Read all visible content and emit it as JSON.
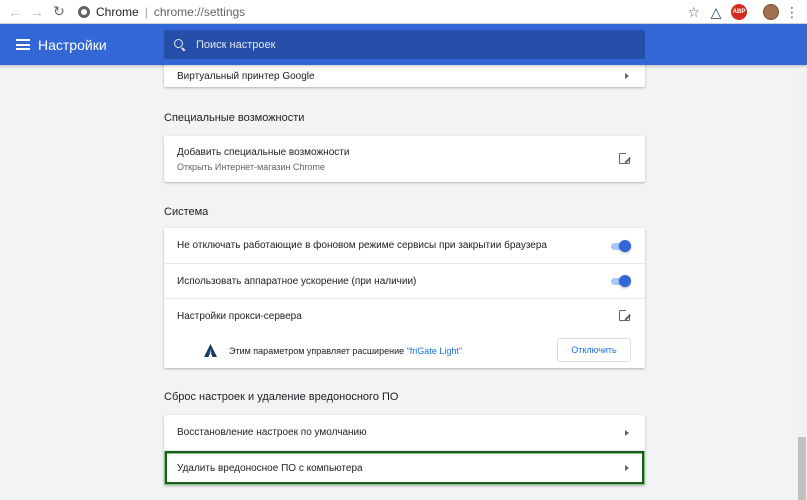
{
  "browser": {
    "chip": "Chrome",
    "url": "chrome://settings"
  },
  "header": {
    "title": "Настройки",
    "search_placeholder": "Поиск настроек"
  },
  "top_row": {
    "label": "Виртуальный принтер Google"
  },
  "accessibility": {
    "section_title": "Специальные возможности",
    "row_title": "Добавить специальные возможности",
    "row_subtitle": "Открыть Интернет-магазин Chrome"
  },
  "system": {
    "section_title": "Система",
    "background_apps": "Не отключать работающие в фоновом режиме сервисы при закрытии браузера",
    "hw_accel": "Использовать аппаратное ускорение (при наличии)",
    "proxy": "Настройки прокси-сервера",
    "ext_notice_prefix": "Этим параметром управляет расширение ",
    "ext_name": "\"friGate Light\"",
    "disable_button": "Отключить"
  },
  "reset": {
    "section_title": "Сброс настроек и удаление вредоносного ПО",
    "restore_defaults": "Восстановление настроек по умолчанию",
    "cleanup": "Удалить вредоносное ПО с компьютера"
  },
  "extensions": {
    "abp": "ABP"
  },
  "colors": {
    "header_blue": "#3367d6",
    "toggle_on": "#3367d6",
    "highlight_green": "#1e5a1e"
  }
}
